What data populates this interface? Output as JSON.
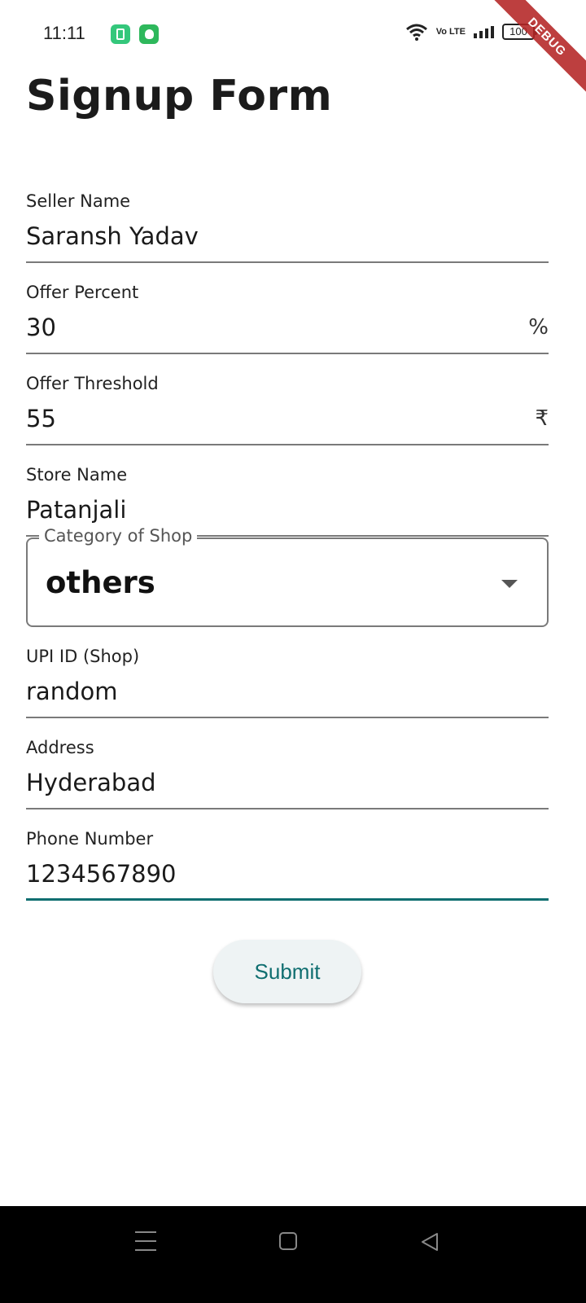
{
  "status_bar": {
    "time": "11:11",
    "network": "Vo LTE",
    "battery": "100",
    "icons": [
      "battery-saver-icon",
      "shield-icon",
      "wifi-icon",
      "volte-icon",
      "signal-icon",
      "battery-icon"
    ]
  },
  "debug_banner": "DEBUG",
  "page": {
    "title": "Signup Form"
  },
  "form": {
    "seller_name": {
      "label": "Seller Name",
      "value": "Saransh Yadav"
    },
    "offer_percent": {
      "label": "Offer Percent",
      "value": "30",
      "suffix": "%"
    },
    "offer_threshold": {
      "label": "Offer Threshold",
      "value": "55",
      "suffix": "₹"
    },
    "store_name": {
      "label": "Store Name",
      "value": "Patanjali"
    },
    "category": {
      "label": "Category of Shop",
      "value": "others"
    },
    "upi_id": {
      "label": "UPI ID (Shop)",
      "value": "random"
    },
    "address": {
      "label": "Address",
      "value": "Hyderabad"
    },
    "phone": {
      "label": "Phone Number",
      "value": "1234567890"
    }
  },
  "actions": {
    "submit_label": "Submit"
  },
  "colors": {
    "accent": "#0f6e70",
    "debug_ribbon": "#b42424"
  }
}
